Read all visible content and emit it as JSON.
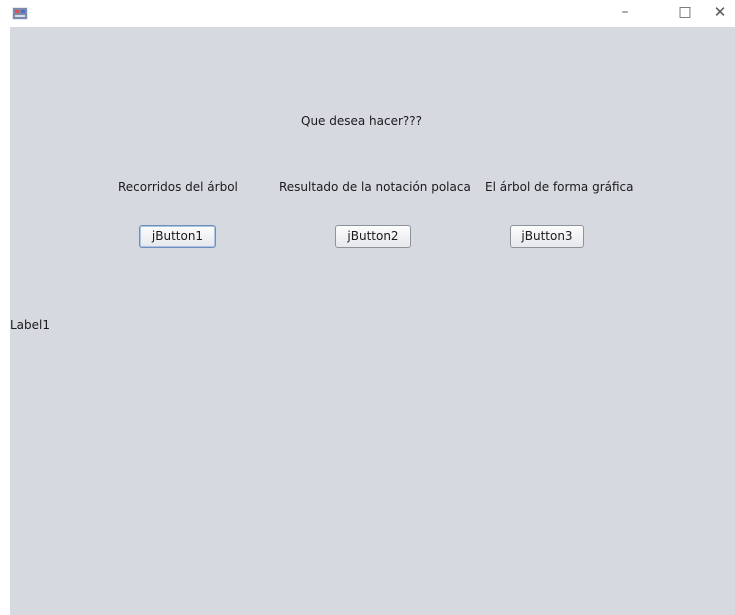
{
  "window": {
    "icon": "java-app-icon",
    "minimize_glyph": "–",
    "maximize_glyph": "□",
    "close_glyph": "✕"
  },
  "content": {
    "question": "Que desea hacer???",
    "options": [
      {
        "label": "Recorridos del árbol",
        "button": "jButton1"
      },
      {
        "label": "Resultado de la notación polaca",
        "button": "jButton2"
      },
      {
        "label": "El árbol de forma gráfica",
        "button": "jButton3"
      }
    ],
    "status_label": "Label1"
  }
}
